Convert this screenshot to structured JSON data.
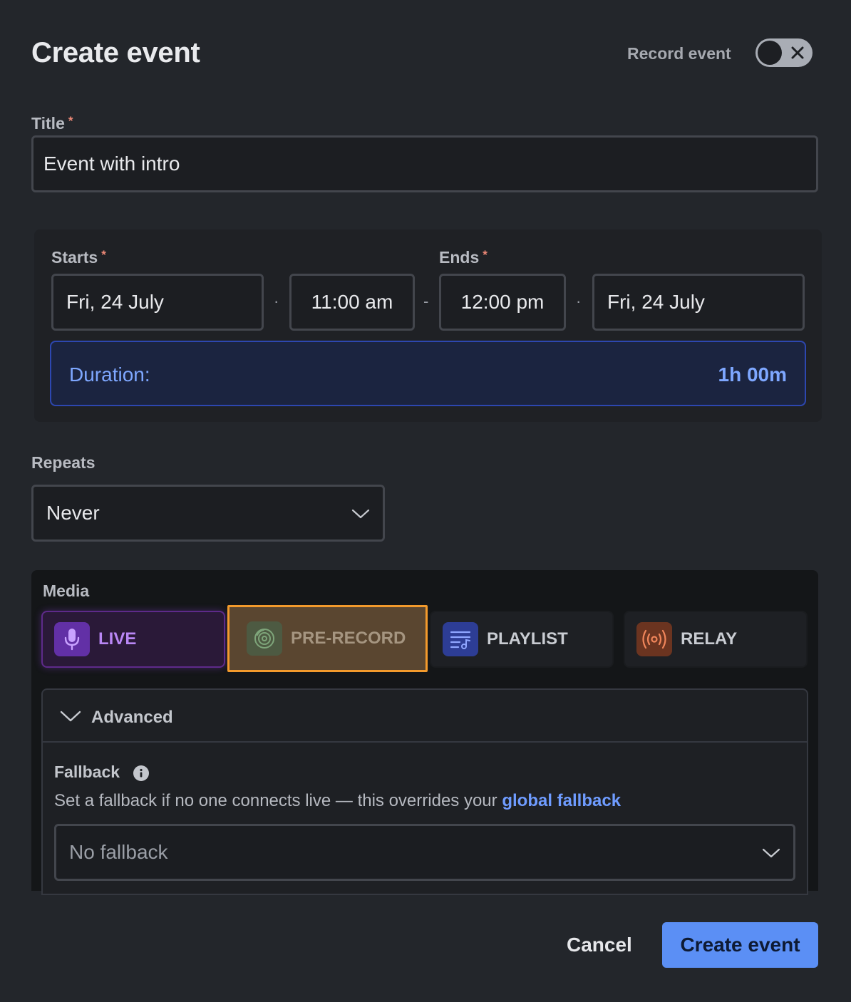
{
  "header": {
    "title": "Create event",
    "record_label": "Record event"
  },
  "title_field": {
    "label": "Title",
    "required_mark": "*",
    "value": "Event with intro"
  },
  "schedule": {
    "starts_label": "Starts",
    "ends_label": "Ends",
    "required_mark": "*",
    "start_date": "Fri, 24 July",
    "start_time": "11:00 am",
    "end_time": "12:00 pm",
    "end_date": "Fri, 24 July",
    "dot": "·",
    "dash": "-",
    "duration_label": "Duration:",
    "duration_value": "1h 00m"
  },
  "repeats": {
    "label": "Repeats",
    "value": "Never"
  },
  "media": {
    "label": "Media",
    "options": [
      {
        "label": "LIVE",
        "icon": "microphone-icon"
      },
      {
        "label": "PRE-RECORD",
        "icon": "vinyl-record-icon"
      },
      {
        "label": "PLAYLIST",
        "icon": "playlist-icon"
      },
      {
        "label": "RELAY",
        "icon": "broadcast-icon"
      }
    ],
    "selected": "PRE-RECORD"
  },
  "advanced": {
    "label": "Advanced",
    "fallback_label": "Fallback",
    "fallback_desc_prefix": "Set a fallback if no one connects live — this overrides your",
    "fallback_link": "global fallback",
    "fallback_value": "No fallback"
  },
  "footer": {
    "cancel": "Cancel",
    "create": "Create event"
  },
  "colors": {
    "accent": "#5b8ff5",
    "live": "#a45cf0",
    "prerecord_highlight": "#f39a2c",
    "playlist": "#4a68e8",
    "relay": "#e3703a"
  }
}
